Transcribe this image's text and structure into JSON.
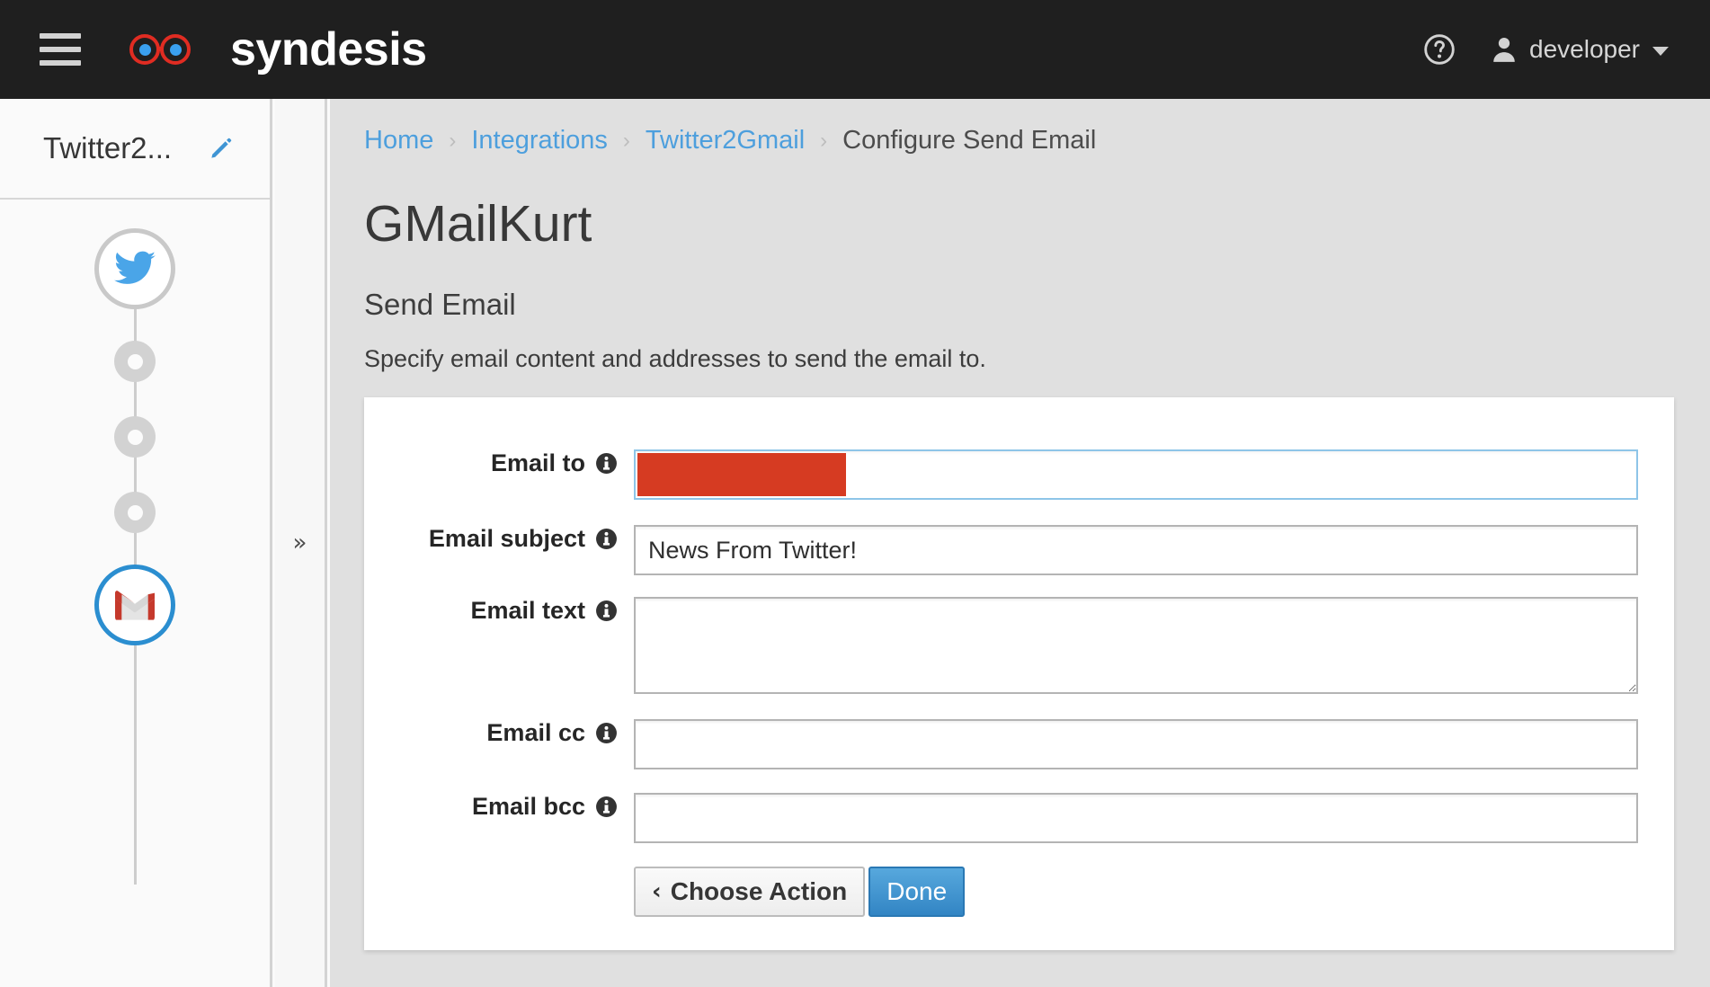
{
  "topnav": {
    "menu_icon": "hamburger-menu-icon",
    "brand_icon": "syndesis-glasses-logo",
    "brand_text": "syndesis",
    "help_icon": "help-circle-icon",
    "avatar_icon": "user-avatar-icon",
    "user_name": "developer",
    "caret_icon": "chevron-down-icon",
    "colors": {
      "bar_bg": "#1f1f1f",
      "logo_red": "#e02c22",
      "logo_blue": "#3aa0ef"
    }
  },
  "flow_panel": {
    "integration_name": "Twitter2...",
    "edit_icon": "pencil-edit-icon",
    "steps": [
      {
        "type": "connection",
        "name": "twitter-connection-node",
        "icon": "twitter-bird-icon",
        "ring_color": "#c9c9c9"
      },
      {
        "type": "add",
        "name": "add-step-node-1",
        "icon": "plus-circle-icon"
      },
      {
        "type": "add",
        "name": "add-step-node-2",
        "icon": "plus-circle-icon"
      },
      {
        "type": "add",
        "name": "add-step-node-3",
        "icon": "plus-circle-icon"
      },
      {
        "type": "connection",
        "name": "gmail-connection-node",
        "icon": "gmail-envelope-icon",
        "ring_color": "#2b8ed0"
      }
    ]
  },
  "gutter": {
    "expand_icon": "double-chevron-right-icon",
    "expand_label": "»"
  },
  "breadcrumb": {
    "items": [
      {
        "label": "Home",
        "link": true
      },
      {
        "label": "Integrations",
        "link": true
      },
      {
        "label": "Twitter2Gmail",
        "link": true
      },
      {
        "label": "Configure Send Email",
        "link": false
      }
    ],
    "separator": "›",
    "link_color": "#4d9fdd"
  },
  "page": {
    "title": "GMailKurt",
    "section_title": "Send Email",
    "section_description": "Specify email content and addresses to send the email to."
  },
  "form": {
    "info_icon": "info-circle-icon",
    "fields": [
      {
        "id": "email-to",
        "label": "Email to",
        "type": "text",
        "value": "",
        "placeholder": "",
        "focused": true,
        "redacted": true,
        "redaction_color": "#d63b22"
      },
      {
        "id": "email-subject",
        "label": "Email subject",
        "type": "text",
        "value": "News From Twitter!",
        "placeholder": "",
        "focused": false,
        "redacted": false
      },
      {
        "id": "email-text",
        "label": "Email text",
        "type": "textarea",
        "value": "",
        "placeholder": "",
        "focused": false,
        "redacted": false
      },
      {
        "id": "email-cc",
        "label": "Email cc",
        "type": "text",
        "value": "",
        "placeholder": "",
        "focused": false,
        "redacted": false
      },
      {
        "id": "email-bcc",
        "label": "Email bcc",
        "type": "text",
        "value": "",
        "placeholder": "",
        "focused": false,
        "redacted": false
      }
    ],
    "buttons": {
      "back_icon": "chevron-left-icon",
      "back_glyph": "‹",
      "back_label": "Choose Action",
      "done_label": "Done",
      "done_color": "#3285c4"
    }
  }
}
